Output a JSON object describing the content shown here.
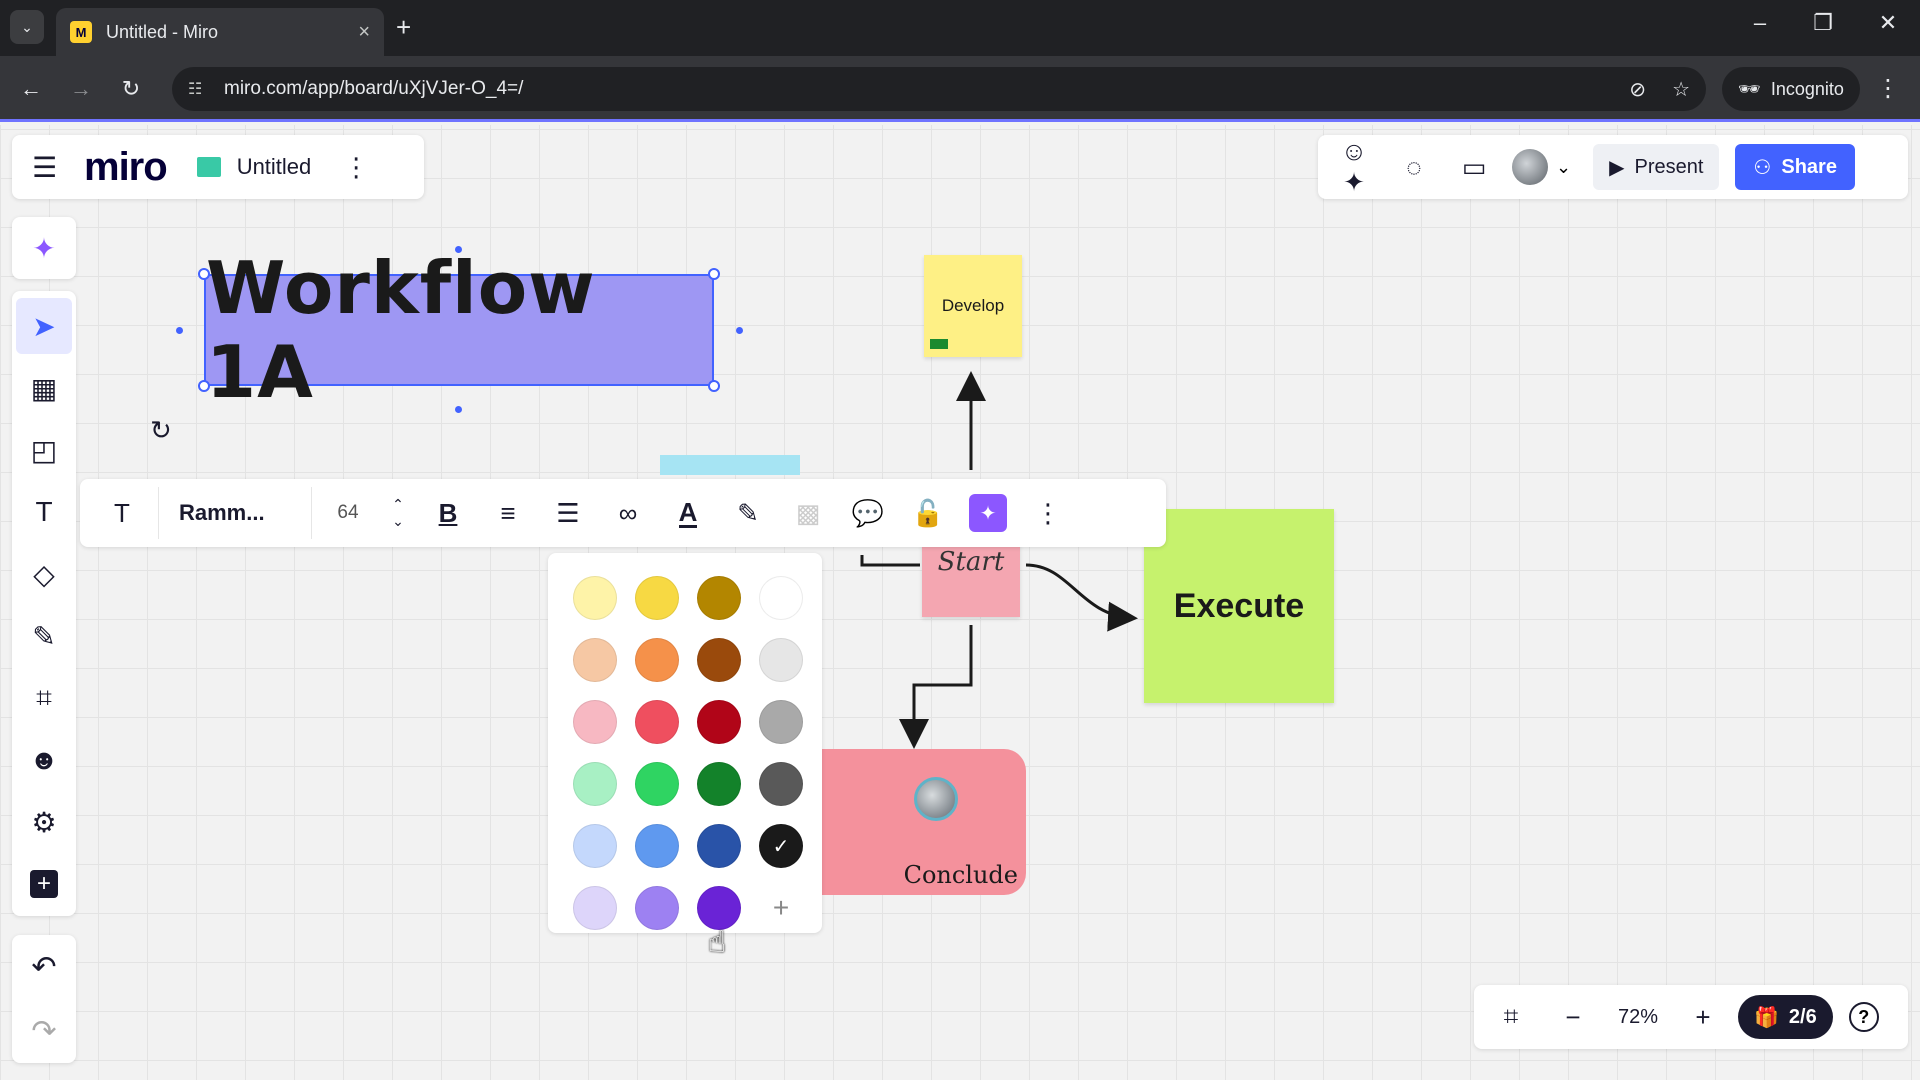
{
  "browser": {
    "tab_title": "Untitled - Miro",
    "favicon": "miro-favicon",
    "url": "miro.com/app/board/uXjVJer-O_4=/",
    "incognito_label": "Incognito",
    "new_tab": "+",
    "close_tab": "×",
    "win_min": "–",
    "win_restore": "❐",
    "win_close": "✕"
  },
  "header": {
    "logo": "miro",
    "board_title": "Untitled",
    "present_label": "Present",
    "share_label": "Share"
  },
  "canvas": {
    "title_text": "Workflow 1A",
    "title_fill_color": "#9e97f3",
    "stickies": {
      "develop": "Develop",
      "start": "Start",
      "execute": "Execute",
      "conclude": "Conclude"
    }
  },
  "context_toolbar": {
    "font_name": "Ramm...",
    "font_size": "64"
  },
  "color_picker": {
    "swatches": [
      [
        "#fef3a8",
        "#f7d943",
        "#b38600",
        "#ffffff"
      ],
      [
        "#f6c8a4",
        "#f5914a",
        "#9a4a0c",
        "#e6e6e6"
      ],
      [
        "#f7b8c2",
        "#ef4f5f",
        "#b10518",
        "#a9a9a9"
      ],
      [
        "#a8f0c4",
        "#2fd462",
        "#13822a",
        "#595959"
      ],
      [
        "#c4d8fc",
        "#5f99ef",
        "#2953a8",
        "#1a1a1a"
      ],
      [
        "#ddd5fa",
        "#9d81f2",
        "#6a23d6",
        "add"
      ]
    ],
    "selected": "#1a1a1a"
  },
  "zoom": {
    "level": "72%",
    "pages": "2/6"
  },
  "colors": {
    "accent": "#4262ff",
    "ai_purple": "#8c57ff"
  }
}
